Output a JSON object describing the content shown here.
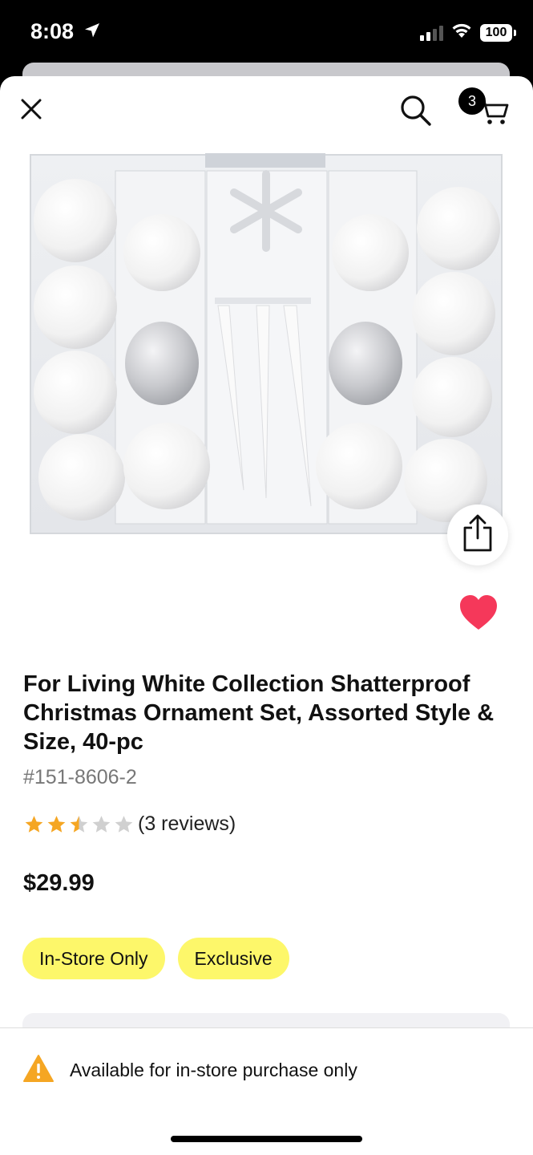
{
  "status_bar": {
    "time": "8:08",
    "battery": "100"
  },
  "header": {
    "cart_count": "3"
  },
  "product": {
    "title": "For Living White Collection Shatterproof Christmas Ornament Set, Assorted Style & Size, 40-pc",
    "sku": "#151-8606-2",
    "rating": 2.5,
    "rating_max": 5,
    "reviews_text": "(3 reviews)",
    "price": "$29.99",
    "badges": [
      "In-Store Only",
      "Exclusive"
    ],
    "favorited": true
  },
  "notice": {
    "text": "Available for in-store purchase only"
  },
  "colors": {
    "accent_yellow": "#fdf76a",
    "heart": "#f5385a",
    "star": "#f5a623",
    "warning": "#f5a623"
  },
  "icons": [
    "location-arrow-icon",
    "signal-icon",
    "wifi-icon",
    "battery-icon",
    "close-icon",
    "search-icon",
    "cart-icon",
    "share-icon",
    "heart-icon",
    "star-icon",
    "warning-icon"
  ]
}
